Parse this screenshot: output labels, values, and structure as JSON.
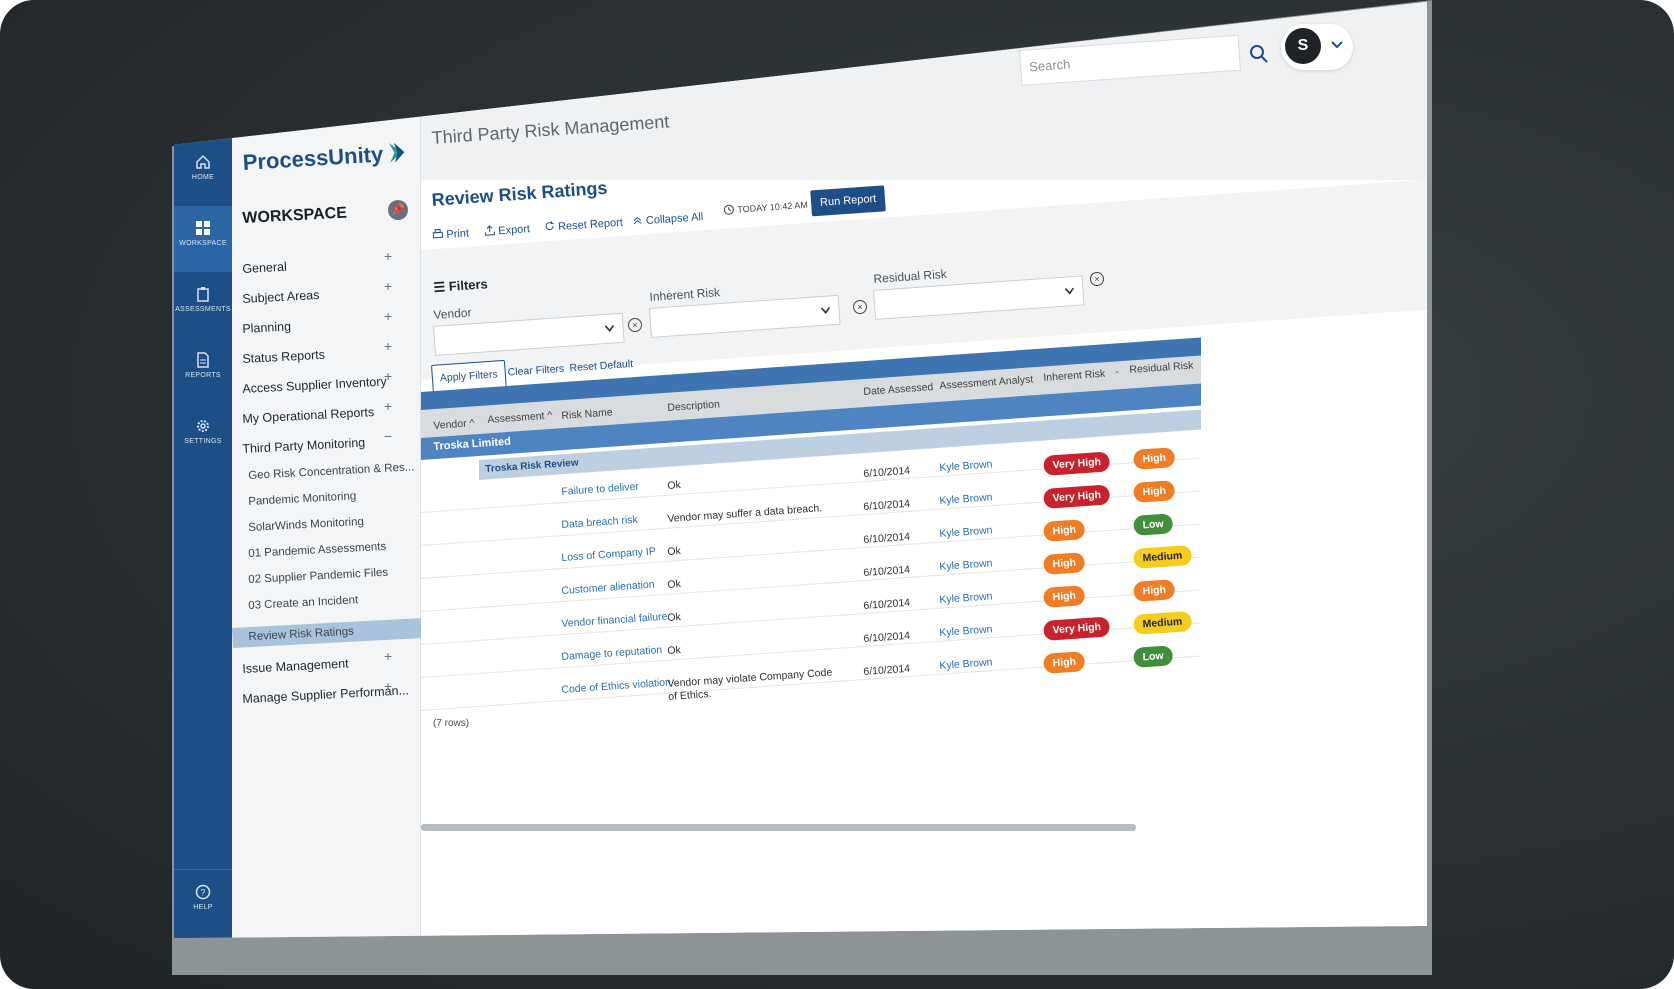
{
  "colors": {
    "brand": "#1d4f86",
    "very_high": "#c8232c",
    "high": "#f07c24",
    "medium": "#f6cd1c",
    "low": "#3f8f3b"
  },
  "rail": {
    "home": "HOME",
    "workspace": "WORKSPACE",
    "assessments": "ASSESSMENTS",
    "reports": "REPORTS",
    "settings": "SETTINGS",
    "help": "HELP"
  },
  "brand": {
    "name": "ProcessUnity"
  },
  "app_title": "Third Party Risk Management",
  "search": {
    "placeholder": "Search"
  },
  "user": {
    "initial": "S"
  },
  "sidebar": {
    "title": "WORKSPACE",
    "items": [
      {
        "label": "General",
        "expand": "+"
      },
      {
        "label": "Subject Areas",
        "expand": "+"
      },
      {
        "label": "Planning",
        "expand": "+"
      },
      {
        "label": "Status Reports",
        "expand": "+"
      },
      {
        "label": "Access Supplier Inventory",
        "expand": "+"
      },
      {
        "label": "My Operational Reports",
        "expand": "+"
      },
      {
        "label": "Third Party Monitoring",
        "expand": "−"
      },
      {
        "label": "Geo Risk Concentration & Res..."
      },
      {
        "label": "Pandemic Monitoring"
      },
      {
        "label": "SolarWinds Monitoring"
      },
      {
        "label": "01 Pandemic Assessments"
      },
      {
        "label": "02 Supplier Pandemic Files"
      },
      {
        "label": "03 Create an Incident"
      },
      {
        "label": "Review Risk Ratings"
      },
      {
        "label": "Issue Management",
        "expand": "+"
      },
      {
        "label": "Manage Supplier Performan...",
        "expand": "+"
      }
    ]
  },
  "panel": {
    "title": "Review Risk Ratings",
    "toolbar": {
      "print": "Print",
      "export": "Export",
      "reset_report": "Reset Report",
      "collapse_all": "Collapse All",
      "timestamp": "TODAY 10:42 AM",
      "run_report": "Run Report"
    }
  },
  "filters": {
    "label": "Filters",
    "vendor": "Vendor",
    "inherent": "Inherent Risk",
    "residual": "Residual Risk",
    "apply": "Apply Filters",
    "clear": "Clear Filters",
    "reset_default": "Reset Default"
  },
  "table": {
    "headers": {
      "vendor": "Vendor",
      "assessment": "Assessment",
      "risk_name": "Risk Name",
      "description": "Description",
      "date_assessed": "Date Assessed",
      "analyst": "Assessment Analyst",
      "inherent": "Inherent Risk",
      "dash": "-",
      "residual": "Residual Risk"
    },
    "vendor_group": "Troska Limited",
    "assessment_group": "Troska Risk Review",
    "rows": [
      {
        "risk": "Failure to deliver",
        "desc": "Ok",
        "date": "6/10/2014",
        "analyst": "Kyle Brown",
        "inherent": "Very High",
        "residual": "High"
      },
      {
        "risk": "Data breach risk",
        "desc": "Vendor may suffer a data breach.",
        "date": "6/10/2014",
        "analyst": "Kyle Brown",
        "inherent": "Very High",
        "residual": "High"
      },
      {
        "risk": "Loss of Company IP",
        "desc": "Ok",
        "date": "6/10/2014",
        "analyst": "Kyle Brown",
        "inherent": "High",
        "residual": "Low"
      },
      {
        "risk": "Customer alienation",
        "desc": "Ok",
        "date": "6/10/2014",
        "analyst": "Kyle Brown",
        "inherent": "High",
        "residual": "Medium"
      },
      {
        "risk": "Vendor financial failure",
        "desc": "Ok",
        "date": "6/10/2014",
        "analyst": "Kyle Brown",
        "inherent": "High",
        "residual": "High"
      },
      {
        "risk": "Damage to reputation",
        "desc": "Ok",
        "date": "6/10/2014",
        "analyst": "Kyle Brown",
        "inherent": "Very High",
        "residual": "Medium"
      },
      {
        "risk": "Code of Ethics violation",
        "desc": "Vendor may violate Company Code of Ethics.",
        "date": "6/10/2014",
        "analyst": "Kyle Brown",
        "inherent": "High",
        "residual": "Low"
      }
    ],
    "row_count": "(7 rows)"
  }
}
